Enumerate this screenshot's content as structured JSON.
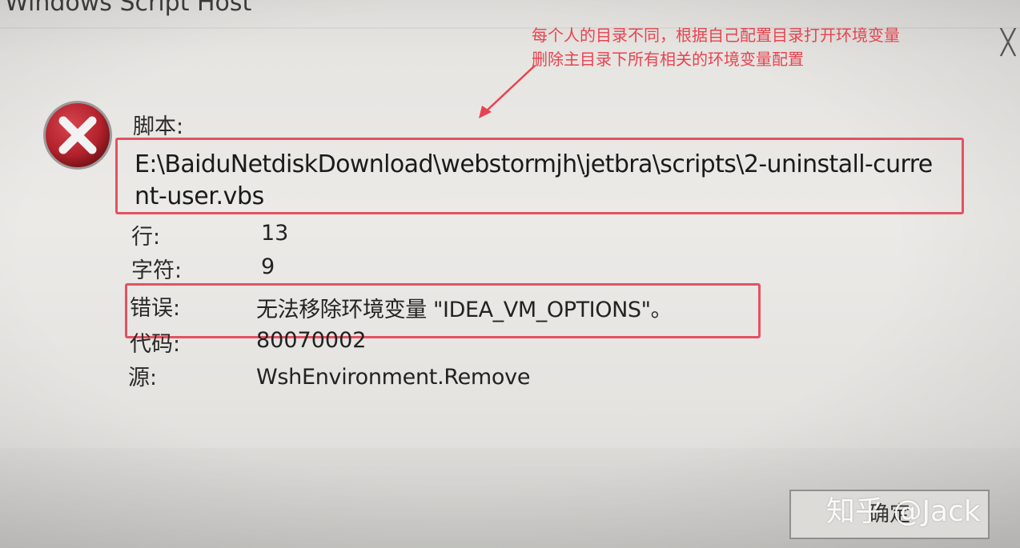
{
  "window": {
    "title": "Windows Script Host",
    "close_glyph": "╳"
  },
  "annotation": {
    "line1": "每个人的目录不同，根据自己配置目录打开环境变量",
    "line2": "删除主目录下所有相关的环境变量配置",
    "color": "#e8434f"
  },
  "error": {
    "icon": "error-x-icon",
    "script_label": "脚本:",
    "script_path_line1": "E:\\BaiduNetdiskDownload\\webstormjh\\jetbra\\scripts\\2-uninstall-curre",
    "script_path_line2": "nt-user.vbs",
    "line_label": "行:",
    "line_value": "13",
    "char_label": "字符:",
    "char_value": "9",
    "error_label": "错误:",
    "error_value": "无法移除环境变量 \"IDEA_VM_OPTIONS\"。",
    "code_label": "代码:",
    "code_value": "80070002",
    "source_label": "源:",
    "source_value": "WshEnvironment.Remove"
  },
  "buttons": {
    "ok_label": "确定"
  },
  "watermark": {
    "text": "知乎 @Jack"
  },
  "colors": {
    "highlight": "#e35262",
    "error_icon": "#b8252f"
  }
}
